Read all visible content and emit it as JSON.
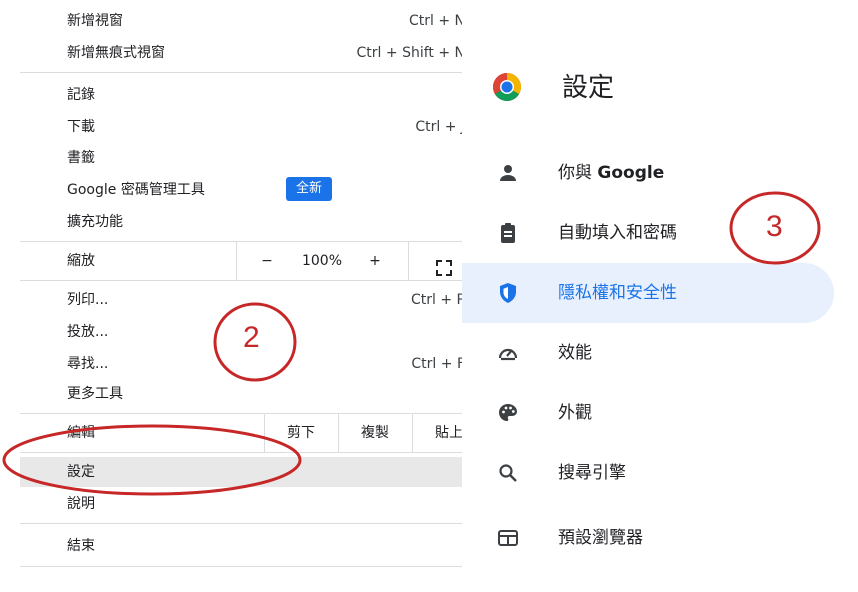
{
  "menu": {
    "new_window": {
      "label": "新增視窗",
      "shortcut": "Ctrl + N"
    },
    "new_incognito": {
      "label": "新增無痕式視窗",
      "shortcut": "Ctrl + Shift + N"
    },
    "history": {
      "label": "記錄"
    },
    "downloads": {
      "label": "下載",
      "shortcut": "Ctrl + J"
    },
    "bookmarks": {
      "label": "書籤"
    },
    "password_manager": {
      "label": "Google 密碼管理工具",
      "badge": "全新"
    },
    "extensions": {
      "label": "擴充功能"
    },
    "zoom": {
      "label": "縮放",
      "minus": "−",
      "value": "100%",
      "plus": "+"
    },
    "print": {
      "label": "列印...",
      "shortcut": "Ctrl + P"
    },
    "cast": {
      "label": "投放..."
    },
    "find": {
      "label": "尋找...",
      "shortcut": "Ctrl + F"
    },
    "more_tools": {
      "label": "更多工具"
    },
    "edit": {
      "label": "編輯",
      "cut": "剪下",
      "copy": "複製",
      "paste": "貼上"
    },
    "settings": {
      "label": "設定"
    },
    "help": {
      "label": "說明"
    },
    "exit": {
      "label": "結束"
    }
  },
  "settings_page": {
    "title": "設定",
    "nav": [
      {
        "label_prefix": "你與 ",
        "label_bold": "Google",
        "icon": "person-icon"
      },
      {
        "label": "自動填入和密碼",
        "icon": "clipboard-icon"
      },
      {
        "label": "隱私權和安全性",
        "icon": "shield-icon",
        "active": true
      },
      {
        "label": "效能",
        "icon": "speedometer-icon"
      },
      {
        "label": "外觀",
        "icon": "palette-icon"
      },
      {
        "label": "搜尋引擎",
        "icon": "search-icon"
      },
      {
        "label": "預設瀏覽器",
        "icon": "browser-icon"
      }
    ]
  },
  "annotations": {
    "step2": "2",
    "step3": "3"
  },
  "colors": {
    "accent": "#1a73e8",
    "active_bg": "#e8f0fe",
    "highlight_bg": "#e8e8e8",
    "annotation": "#c62828"
  }
}
